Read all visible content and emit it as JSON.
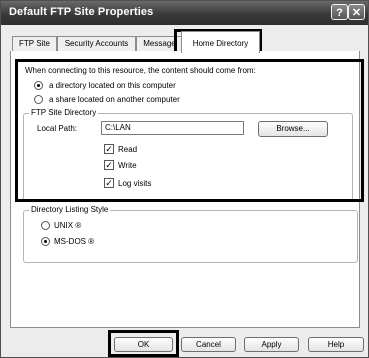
{
  "window": {
    "title": "Default FTP Site Properties",
    "help_glyph": "?",
    "close_glyph": "✕"
  },
  "tabs": [
    {
      "label": "FTP Site"
    },
    {
      "label": "Security Accounts"
    },
    {
      "label": "Message"
    },
    {
      "label": "Home Directory"
    }
  ],
  "content_source": {
    "prompt": "When connecting to this resource, the content should come from:",
    "options": [
      {
        "label": "a directory located on this computer",
        "selected": true
      },
      {
        "label": "a share located on another computer",
        "selected": false
      }
    ]
  },
  "ftp_site_directory": {
    "legend": "FTP Site Directory",
    "local_path_label": "Local Path:",
    "local_path_value": "C:\\LAN",
    "browse_label": "Browse...",
    "permissions": [
      {
        "label": "Read",
        "checked": true
      },
      {
        "label": "Write",
        "checked": true
      },
      {
        "label": "Log visits",
        "checked": true
      }
    ]
  },
  "directory_listing_style": {
    "legend": "Directory Listing Style",
    "options": [
      {
        "label": "UNIX ®",
        "selected": false
      },
      {
        "label": "MS-DOS ®",
        "selected": true
      }
    ]
  },
  "footer": {
    "ok_label": "OK",
    "cancel_label": "Cancel",
    "apply_label": "Apply",
    "help_label": "Help"
  },
  "colors": {
    "title_bar": "#3a3a3a",
    "highlight_border": "#000000"
  }
}
